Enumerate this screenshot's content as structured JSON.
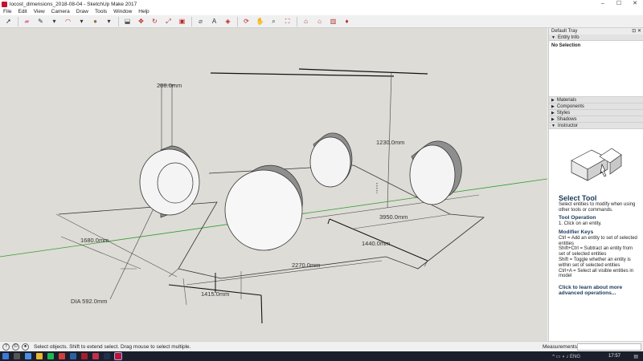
{
  "window": {
    "title": "locost_dimensions_2018-08-04 - SketchUp Make 2017"
  },
  "menu": [
    "File",
    "Edit",
    "View",
    "Camera",
    "Draw",
    "Tools",
    "Window",
    "Help"
  ],
  "toolbar": {
    "tools": [
      {
        "name": "select-tool-icon",
        "glyph": "➚",
        "color": "#222"
      },
      {
        "name": "eraser-tool-icon",
        "glyph": "▰",
        "color": "#e07aa0"
      },
      {
        "name": "pencil-tool-icon",
        "glyph": "✎",
        "color": "#333"
      },
      {
        "name": "line-dropdown-icon",
        "glyph": "▾",
        "color": "#333"
      },
      {
        "name": "arc-tool-icon",
        "glyph": "◠",
        "color": "#c03030"
      },
      {
        "name": "arc-dropdown-icon",
        "glyph": "▾",
        "color": "#333"
      },
      {
        "name": "shapes-tool-icon",
        "glyph": "●",
        "color": "#8a6e40"
      },
      {
        "name": "shapes-dropdown-icon",
        "glyph": "▾",
        "color": "#333"
      },
      {
        "name": "push-pull-tool-icon",
        "glyph": "⬓",
        "color": "#5a5a5a"
      },
      {
        "name": "move-tool-icon",
        "glyph": "✥",
        "color": "#c02020"
      },
      {
        "name": "rotate-tool-icon",
        "glyph": "↻",
        "color": "#c02020"
      },
      {
        "name": "scale-tool-icon",
        "glyph": "⤢",
        "color": "#c02020"
      },
      {
        "name": "offset-tool-icon",
        "glyph": "▣",
        "color": "#c02020"
      },
      {
        "name": "tape-measure-tool-icon",
        "glyph": "⌀",
        "color": "#555"
      },
      {
        "name": "text-tool-icon",
        "glyph": "A",
        "color": "#333"
      },
      {
        "name": "paint-bucket-tool-icon",
        "glyph": "◈",
        "color": "#c02020"
      },
      {
        "name": "orbit-tool-icon",
        "glyph": "⟳",
        "color": "#c02020"
      },
      {
        "name": "pan-tool-icon",
        "glyph": "✋",
        "color": "#a0522d"
      },
      {
        "name": "zoom-tool-icon",
        "glyph": "⌕",
        "color": "#333"
      },
      {
        "name": "zoom-extents-tool-icon",
        "glyph": "⛶",
        "color": "#c02020"
      },
      {
        "name": "warehouse-icon",
        "glyph": "⌂",
        "color": "#b03030"
      },
      {
        "name": "extension-warehouse-icon",
        "glyph": "⌂",
        "color": "#c04040"
      },
      {
        "name": "send-to-layout-icon",
        "glyph": "▥",
        "color": "#b03030"
      },
      {
        "name": "extension-manager-icon",
        "glyph": "♦",
        "color": "#c02020"
      }
    ]
  },
  "dimensions": {
    "d_top": "208.0mm",
    "d_height": "1230.0mm",
    "d_width": "1680.0mm",
    "d_length": "3950.0mm",
    "d_1440": "1440.0mm",
    "d_2270": "2270.0mm",
    "d_1415": "1415.0mm",
    "d_dia": "DIA 592.0mm"
  },
  "tray": {
    "title": "Default Tray",
    "panels": {
      "entity_info": "Entity Info",
      "no_selection": "No Selection",
      "materials": "Materials",
      "components": "Components",
      "styles": "Styles",
      "shadows": "Shadows",
      "instructor": "Instructor"
    },
    "instructor": {
      "tool_title": "Select Tool",
      "tool_desc": "Select entities to modify when using other tools or commands.",
      "op_head": "Tool Operation",
      "op_1": "1. Click on an entity.",
      "mod_head": "Modifier Keys",
      "mod_1": "Ctrl = Add an entity to set of selected entities",
      "mod_2": "Shift+Ctrl = Subtract an entity from set of selected entities",
      "mod_3": "Shift = Toggle whether an entity is within set of selected entities",
      "mod_4": "Ctrl+A = Select all visible entities in model",
      "link": "Click to learn about more advanced operations..."
    }
  },
  "status": {
    "text": "Select objects. Shift to extend select. Drag mouse to select multiple.",
    "measurements_label": "Measurements"
  },
  "taskbar": {
    "clock": "17:57"
  }
}
